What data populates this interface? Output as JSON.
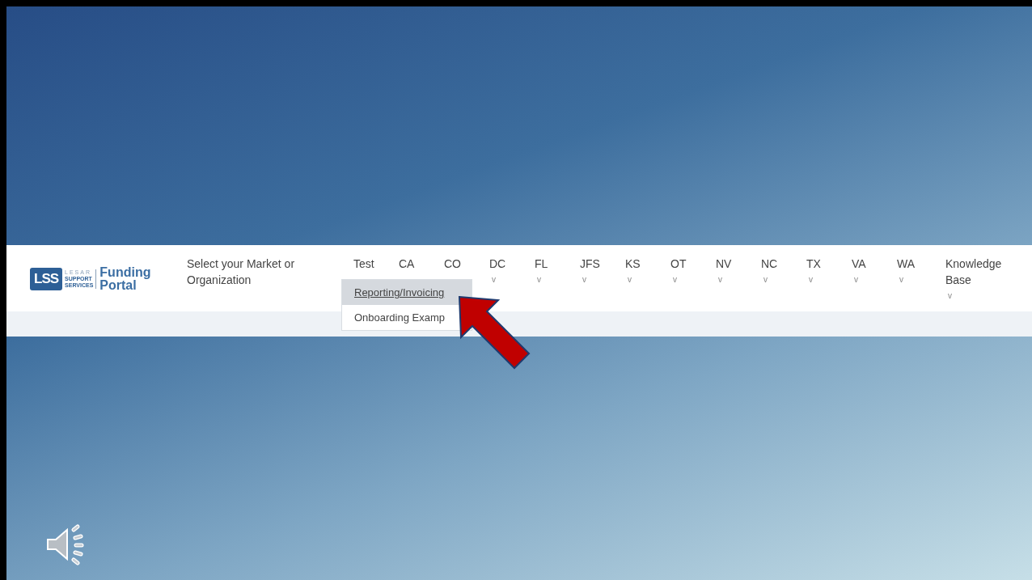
{
  "logo": {
    "mark": "LSS",
    "lines": [
      "LESAR",
      "SUPPORT",
      "SERVICES"
    ],
    "title": [
      "Funding",
      "Portal"
    ]
  },
  "prompt": "Select your Market or Organization",
  "menus": [
    {
      "label": "Test"
    },
    {
      "label": "CA"
    },
    {
      "label": "CO"
    },
    {
      "label": "DC",
      "caret": "v"
    },
    {
      "label": "FL",
      "caret": "v"
    },
    {
      "label": "JFS",
      "caret": "v"
    },
    {
      "label": "KS",
      "caret": "v"
    },
    {
      "label": "OT",
      "caret": "v"
    },
    {
      "label": "NV",
      "caret": "v"
    },
    {
      "label": "NC",
      "caret": "v"
    },
    {
      "label": "TX",
      "caret": "v"
    },
    {
      "label": "VA",
      "caret": "v"
    },
    {
      "label": "WA",
      "caret": "v"
    },
    {
      "label": "Knowledge Base",
      "caret": "v"
    }
  ],
  "dropdown": [
    {
      "label": "Reporting/Invoicing",
      "selected": true
    },
    {
      "label": "Onboarding Examp",
      "selected": false
    }
  ]
}
